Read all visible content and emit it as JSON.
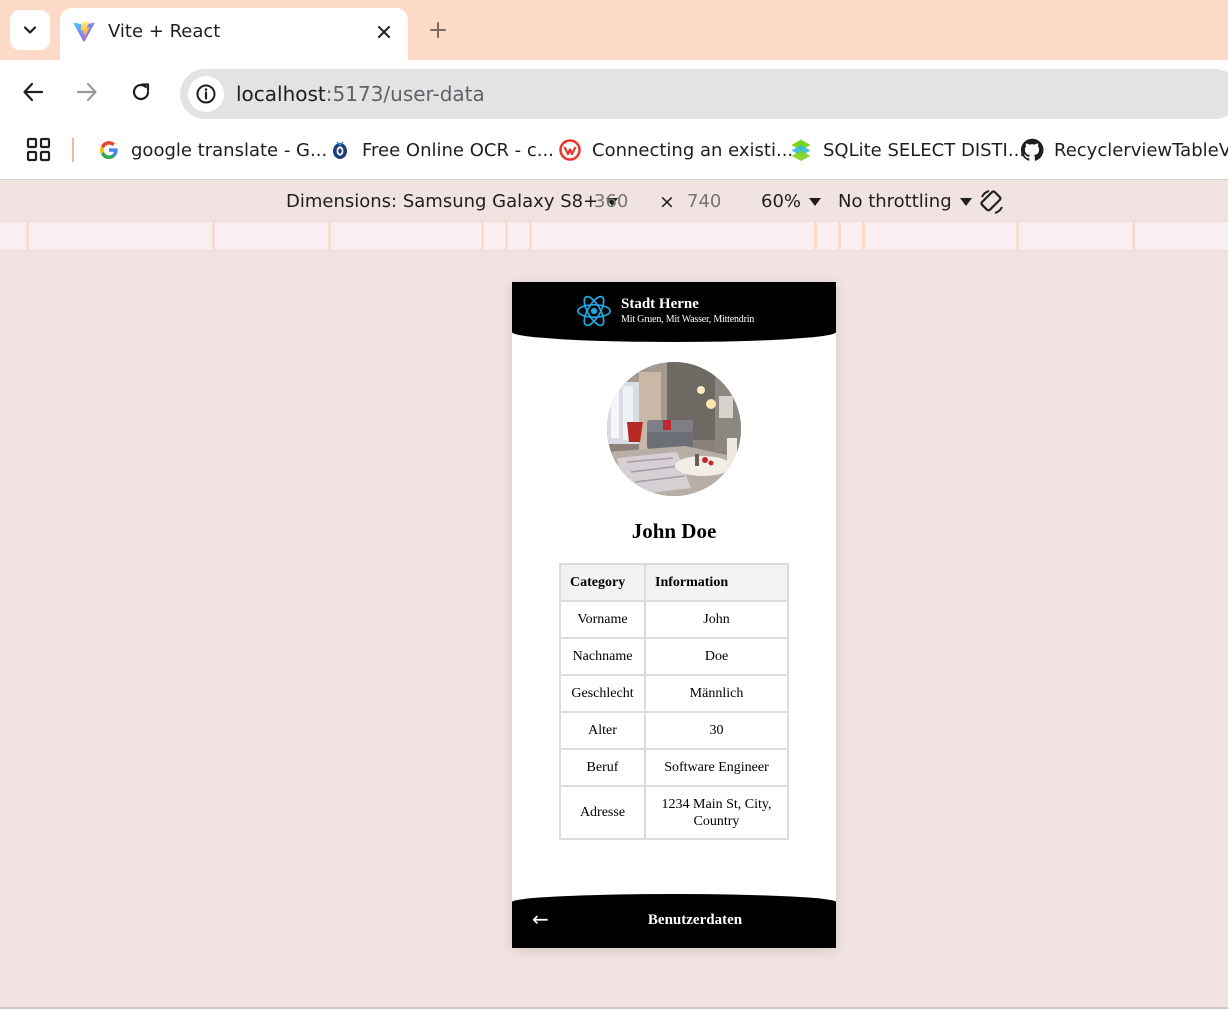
{
  "browser": {
    "tab": {
      "title": "Vite + React"
    },
    "omnibox": {
      "host": "localhost",
      "rest": ":5173/user-data"
    },
    "bookmarks": [
      {
        "label": "google translate - G...",
        "icon": "google-icon"
      },
      {
        "label": "Free Online OCR - c...",
        "icon": "ocr-icon"
      },
      {
        "label": "Connecting an existi...",
        "icon": "jetbrains-icon"
      },
      {
        "label": "SQLite SELECT DISTI...",
        "icon": "sqlitetutorial-icon"
      },
      {
        "label": "RecyclerviewTableVi...",
        "icon": "github-icon"
      }
    ]
  },
  "devtools": {
    "dimensions_label": "Dimensions: Samsung Galaxy S8+",
    "width": "360",
    "times": "×",
    "height": "740",
    "zoom": "60%",
    "throttling": "No throttling"
  },
  "app": {
    "brand_title": "Stadt Herne",
    "brand_subtitle": "Mit Gruen, Mit Wasser, Mittendrin",
    "user_name": "John Doe",
    "table": {
      "headers": [
        "Category",
        "Information"
      ],
      "rows": [
        [
          "Vorname",
          "John"
        ],
        [
          "Nachname",
          "Doe"
        ],
        [
          "Geschlecht",
          "Männlich"
        ],
        [
          "Alter",
          "30"
        ],
        [
          "Beruf",
          "Software Engineer"
        ],
        [
          "Adresse",
          "1234 Main St, City, Country"
        ]
      ]
    },
    "footer_back": "←",
    "footer_title": "Benutzerdaten"
  },
  "colors": {
    "tabstrip": "#fddac8",
    "page_background": "#f1e3e1",
    "app_bar": "#000000",
    "react_blue": "#1fa9e1"
  }
}
